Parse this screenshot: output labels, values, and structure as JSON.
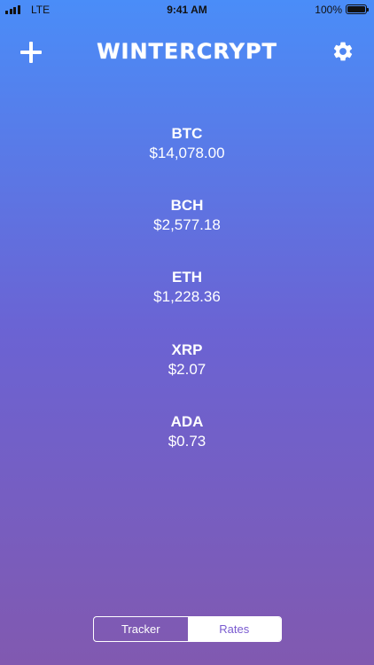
{
  "status_bar": {
    "carrier": "LTE",
    "time": "9:41 AM",
    "battery": "100%"
  },
  "header": {
    "title": "WINTERCRYPT",
    "add_icon": "plus-icon",
    "settings_icon": "gear-icon"
  },
  "coins": [
    {
      "symbol": "BTC",
      "price": "$14,078.00"
    },
    {
      "symbol": "BCH",
      "price": "$2,577.18"
    },
    {
      "symbol": "ETH",
      "price": "$1,228.36"
    },
    {
      "symbol": "XRP",
      "price": "$2.07"
    },
    {
      "symbol": "ADA",
      "price": "$0.73"
    }
  ],
  "tabs": [
    {
      "label": "Tracker",
      "selected": false
    },
    {
      "label": "Rates",
      "selected": true
    }
  ],
  "colors": {
    "gradient_top": "#4a8df8",
    "gradient_bottom": "#8159b0",
    "selected_tab_text": "#7a5bd0"
  }
}
